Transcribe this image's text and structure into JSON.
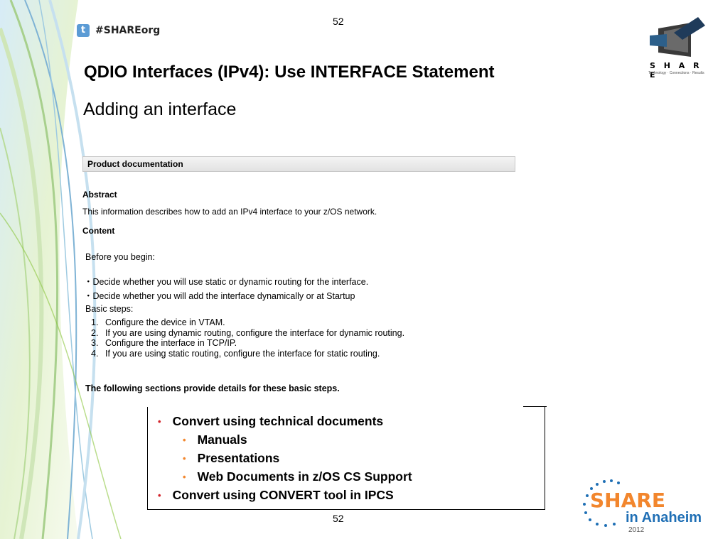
{
  "header": {
    "twitter_icon": "t",
    "twitter_handle": "#SHAREorg",
    "slide_number": "52",
    "share_logo_word": "S H A R E",
    "share_logo_tagline": "Technology · Connections · Results"
  },
  "title": "QDIO Interfaces (IPv4):  Use INTERFACE Statement",
  "doc": {
    "heading": "Adding an interface",
    "bar_label": "Product documentation",
    "abstract_heading": "Abstract",
    "abstract_text": "This information describes how to add an IPv4 interface to your z/OS network.",
    "content_heading": "Content",
    "before": "Before you begin:",
    "bullets": [
      "・Decide whether you will use static or dynamic routing for the interface.",
      "・Decide whether you will add the interface dynamically or at Startup"
    ],
    "basic_steps": "Basic steps:",
    "steps": [
      {
        "num": "1.",
        "text": "Configure the device in VTAM."
      },
      {
        "num": "2.",
        "text": "If you are using dynamic routing, configure the interface for dynamic routing."
      },
      {
        "num": "3.",
        "text": "Configure the interface in TCP/IP."
      },
      {
        "num": "4.",
        "text": "If you are using static routing, configure the interface for static routing."
      }
    ],
    "following": "The following sections provide details for these basic steps."
  },
  "callout": {
    "items": [
      "Convert using technical documents",
      "Manuals",
      "Presentations",
      "Web Documents in z/OS CS Support",
      "Convert using CONVERT tool in IPCS"
    ]
  },
  "footer": {
    "slide_number": "52",
    "anaheim_share": "SHARE",
    "anaheim_in": "in Anaheim",
    "anaheim_year": "2012"
  },
  "colors": {
    "bullet_red": "#d2232a",
    "bullet_orange": "#f2862d",
    "share_orange": "#f2862d",
    "anaheim_blue": "#1f6fb5",
    "swirl_green": "#8cc63f",
    "swirl_blue": "#7fb3d5"
  }
}
